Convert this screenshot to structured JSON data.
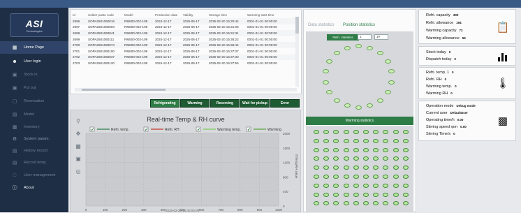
{
  "sidebar": {
    "logo_main": "ASI",
    "logo_sub": "Technologies",
    "items": [
      {
        "label": "Home Page",
        "icon": "grid-icon"
      },
      {
        "label": "User login",
        "icon": "user-icon"
      },
      {
        "label": "Stock in",
        "icon": "stock-in-icon"
      },
      {
        "label": "Put out",
        "icon": "put-out-icon"
      },
      {
        "label": "Reservation",
        "icon": "reservation-icon"
      },
      {
        "label": "Model",
        "icon": "model-icon"
      },
      {
        "label": "Inventory",
        "icon": "inventory-icon"
      },
      {
        "label": "System param.",
        "icon": "param-icon"
      },
      {
        "label": "History record",
        "icon": "history-icon"
      },
      {
        "label": "Record temp.",
        "icon": "record-icon"
      },
      {
        "label": "User management",
        "icon": "users-icon"
      },
      {
        "label": "About",
        "icon": "info-icon"
      }
    ]
  },
  "table": {
    "columns": [
      "Id",
      "Solder paste code",
      "Model",
      "Production date",
      "Validity",
      "Storage time",
      "Warming start time"
    ],
    "rows": [
      [
        "2696",
        "SOPA2501060016",
        "RM500-002-109",
        "2024-12-17",
        "2025-06-17",
        "2025-02-20 15:30:44",
        "0001-01-01 00:00:00"
      ],
      [
        "2697",
        "SOPA2501060004",
        "RM500-002-109",
        "2024-12-17",
        "2025-06-17",
        "2025-02-20 15:31:06",
        "0001-01-01 00:00:00"
      ],
      [
        "2698",
        "SOPA2501060041",
        "RM500-002-109",
        "2024-12-17",
        "2025-06-17",
        "2025-02-20 15:31:31",
        "0001-01-01 00:00:00"
      ],
      [
        "2699",
        "SOPA2501060111",
        "RM500-002-109",
        "2024-12-17",
        "2025-06-17",
        "2025-02-20 15:36:22",
        "0001-01-01 00:00:00"
      ],
      [
        "2700",
        "SOPA2501060074",
        "RM500-002-109",
        "2024-12-17",
        "2025-06-17",
        "2025-02-20 15:36:44",
        "0001-01-01 00:00:00"
      ],
      [
        "2701",
        "SOPA2501060100",
        "RM500-002-109",
        "2024-12-17",
        "2025-06-17",
        "2025-02-20 15:37:07",
        "0001-01-01 00:00:00"
      ],
      [
        "2702",
        "SOPA2501060037",
        "RM500-002-109",
        "2024-12-17",
        "2025-06-17",
        "2025-02-20 15:37:30",
        "0001-01-01 00:00:00"
      ],
      [
        "2703",
        "SOPA2501060120",
        "RM500-002-109",
        "2024-12-17",
        "2025-06-17",
        "2025-02-20 15:37:55",
        "0001-01-01 00:00:00"
      ]
    ]
  },
  "status_buttons": [
    "Refrigerating",
    "Warming",
    "Reserving",
    "Wait for pickup",
    "Error"
  ],
  "chart": {
    "title": "Real-time Temp & RH curve",
    "legend": [
      "Refri. temp.",
      "Refri. RH",
      "Warming temp.",
      "Warming"
    ],
    "right_axis_label": "T/Temp/RH value",
    "y_ticks": [
      "2000",
      "1600",
      "1200",
      "800",
      "400",
      "0"
    ],
    "x_ticks": [
      "0",
      "100",
      "200",
      "300",
      "400",
      "500",
      "600",
      "700",
      "800",
      "900",
      "1000"
    ],
    "timestamp": "2025-02-20 15:40:00 [#]"
  },
  "chart_data": {
    "type": "line",
    "title": "Real-time Temp & RH curve",
    "series": [
      {
        "name": "Refri. temp.",
        "values": []
      },
      {
        "name": "Refri. RH",
        "values": []
      },
      {
        "name": "Warming temp.",
        "values": []
      },
      {
        "name": "Warming",
        "values": []
      }
    ],
    "ylim": [
      0,
      2000
    ],
    "xlim": [
      0,
      1000
    ],
    "grid": true,
    "legend": "top"
  },
  "stats": {
    "tab_data": "Data statistics",
    "tab_position": "Position statistics",
    "refri_statistics": "Refri. statistics",
    "select1": "1",
    "select2": "1#",
    "warming_statistics": "Warming statistics"
  },
  "colors": {
    "sidebar_bg": "#1e2e45",
    "accent_green": "#2e7d46",
    "header_green": "#1e5a32",
    "slot_fill": "#cdeeb8"
  },
  "cards": {
    "capacity": [
      {
        "label": "Refri. capacity",
        "value": "300"
      },
      {
        "label": "Refri. allowance",
        "value": "194"
      },
      {
        "label": "Warming capacity",
        "value": "72"
      },
      {
        "label": "Warming allowance",
        "value": "59"
      }
    ],
    "stock": [
      {
        "label": "Stock today",
        "value": "0"
      },
      {
        "label": "Dispatch today",
        "value": "0"
      }
    ],
    "env": [
      {
        "label": "Refri. temp. 1",
        "value": "0"
      },
      {
        "label": "Refri. RH",
        "value": "0"
      },
      {
        "label": "Warming temp.",
        "value": "0"
      },
      {
        "label": "Warming RH",
        "value": "0"
      }
    ],
    "op": [
      {
        "label": "Operation mode",
        "value": "Debug mode"
      },
      {
        "label": "Current user",
        "value": "DefaultUser"
      },
      {
        "label": "Operating time/h",
        "value": "0.00"
      },
      {
        "label": "Stirring speed rpm",
        "value": "0.00"
      },
      {
        "label": "Stirring Time/s",
        "value": "0"
      }
    ]
  }
}
